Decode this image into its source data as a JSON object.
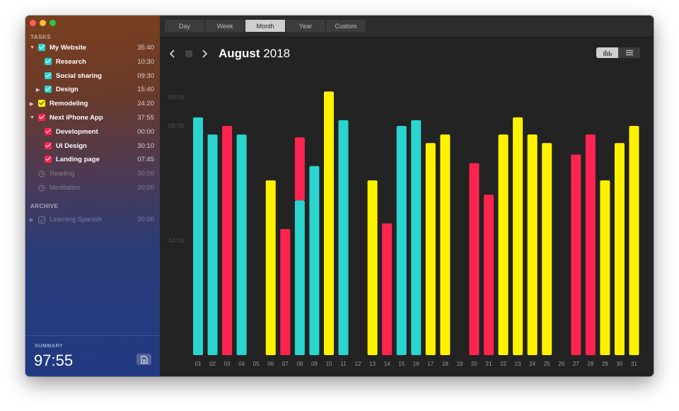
{
  "sidebar": {
    "tasks_label": "TASKS",
    "archive_label": "ARCHIVE",
    "tasks": [
      {
        "name": "My Website",
        "time": "35:40",
        "color": "#2ad4cf",
        "level": 0,
        "arrow": "down"
      },
      {
        "name": "Research",
        "time": "10:30",
        "color": "#2ad4cf",
        "level": 1,
        "arrow": ""
      },
      {
        "name": "Social sharing",
        "time": "09:30",
        "color": "#2ad4cf",
        "level": 1,
        "arrow": ""
      },
      {
        "name": "Design",
        "time": "15:40",
        "color": "#2ad4cf",
        "level": 1,
        "arrow": "right"
      },
      {
        "name": "Remodeling",
        "time": "24:20",
        "color": "#fff200",
        "level": 0,
        "arrow": "right"
      },
      {
        "name": "Next iPhone App",
        "time": "37:55",
        "color": "#ff2450",
        "level": 0,
        "arrow": "down"
      },
      {
        "name": "Development",
        "time": "00:00",
        "color": "#ff2450",
        "level": 1,
        "arrow": ""
      },
      {
        "name": "UI Design",
        "time": "30:10",
        "color": "#ff2450",
        "level": 1,
        "arrow": ""
      },
      {
        "name": "Landing page",
        "time": "07:45",
        "color": "#ff2450",
        "level": 1,
        "arrow": ""
      }
    ],
    "inactive": [
      {
        "name": "Reading",
        "time": "00:00",
        "icon": "clock-icon"
      },
      {
        "name": "Meditation",
        "time": "00:00",
        "icon": "clock-icon"
      }
    ],
    "archive": [
      {
        "name": "Learning Spanish",
        "time": "00:00"
      }
    ],
    "summary_label": "SUMMARY",
    "summary_value": "97:55"
  },
  "toolbar": {
    "tabs": [
      "Day",
      "Week",
      "Month",
      "Year",
      "Custom"
    ],
    "active_tab": "Month"
  },
  "header": {
    "month": "August",
    "year": "2018",
    "prev_icon": "chevron-left-icon",
    "next_icon": "chevron-right-icon",
    "stop_icon": "stop-icon",
    "view_options": [
      "bar-chart-icon",
      "list-icon"
    ],
    "active_view": "bar-chart-icon"
  },
  "colors": {
    "cyan": "#2ad4cf",
    "yellow": "#fff200",
    "red": "#ff2450"
  },
  "chart_data": {
    "type": "bar",
    "stacked": true,
    "y_unit": "hours",
    "ylim": [
      0,
      10
    ],
    "y_ticks": [
      {
        "label": "04:00",
        "value": 4
      },
      {
        "label": "08:00",
        "value": 8
      },
      {
        "label": "09:00",
        "value": 9
      }
    ],
    "categories": [
      "01",
      "02",
      "03",
      "04",
      "05",
      "06",
      "07",
      "08",
      "09",
      "10",
      "11",
      "12",
      "13",
      "14",
      "15",
      "16",
      "17",
      "18",
      "19",
      "20",
      "21",
      "22",
      "23",
      "24",
      "25",
      "26",
      "27",
      "28",
      "29",
      "30",
      "31"
    ],
    "series": [
      {
        "color": "#2ad4cf",
        "values": [
          8.3,
          7.7,
          0,
          7.7,
          0,
          0,
          0,
          5.4,
          6.6,
          0,
          8.2,
          0,
          0,
          0,
          8.0,
          8.2,
          0,
          0,
          0,
          0,
          0,
          0,
          0,
          0,
          0,
          0,
          0,
          0,
          0,
          0,
          0
        ]
      },
      {
        "color": "#fff200",
        "values": [
          0,
          0,
          0,
          0,
          0,
          6.1,
          0,
          0,
          0,
          9.2,
          0,
          0,
          6.1,
          0,
          0,
          0,
          7.4,
          7.7,
          0,
          0,
          0,
          7.7,
          8.3,
          7.7,
          7.4,
          0,
          0,
          0,
          6.1,
          7.4,
          8.0
        ]
      },
      {
        "color": "#ff2450",
        "values": [
          0,
          0,
          8.0,
          0,
          0,
          0,
          4.4,
          2.2,
          0,
          0,
          0,
          0,
          0,
          4.6,
          0,
          0,
          0,
          0,
          0,
          6.7,
          5.6,
          0,
          0,
          0,
          0,
          0,
          7.0,
          7.7,
          0,
          0,
          0
        ]
      }
    ]
  }
}
